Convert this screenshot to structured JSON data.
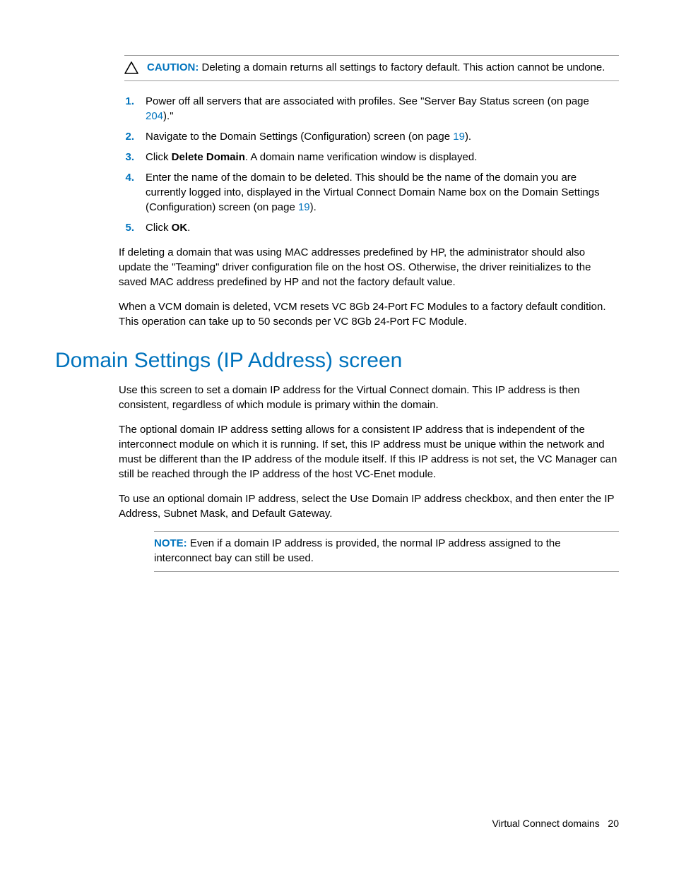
{
  "caution": {
    "label": "CAUTION:",
    "text": "Deleting a domain returns all settings to factory default. This action cannot be undone."
  },
  "steps": [
    {
      "num": "1.",
      "pre": "Power off all servers that are associated with profiles. See \"Server Bay Status screen (on page ",
      "link": "204",
      "post": ").\""
    },
    {
      "num": "2.",
      "pre": "Navigate to the Domain Settings (Configuration) screen (on page ",
      "link": "19",
      "post": ")."
    },
    {
      "num": "3.",
      "pre": "Click ",
      "bold": "Delete Domain",
      "post": ". A domain name verification window is displayed."
    },
    {
      "num": "4.",
      "pre": "Enter the name of the domain to be deleted. This should be the name of the domain you are currently logged into, displayed in the Virtual Connect Domain Name box on the Domain Settings (Configuration) screen (on page ",
      "link": "19",
      "post": ")."
    },
    {
      "num": "5.",
      "pre": "Click ",
      "bold": "OK",
      "post": "."
    }
  ],
  "para1": "If deleting a domain that was using MAC addresses predefined by HP, the administrator should also update the \"Teaming\" driver configuration file on the host OS. Otherwise, the driver reinitializes to the saved MAC address predefined by HP and not the factory default value.",
  "para2": "When a VCM domain is deleted, VCM resets VC 8Gb 24-Port FC Modules to a factory default condition. This operation can take up to 50 seconds per VC 8Gb 24-Port FC Module.",
  "heading": "Domain Settings (IP Address) screen",
  "para3": "Use this screen to set a domain IP address for the Virtual Connect domain. This IP address is then consistent, regardless of which module is primary within the domain.",
  "para4": "The optional domain IP address setting allows for a consistent IP address that is independent of the interconnect module on which it is running. If set, this IP address must be unique within the network and must be different than the IP address of the module itself. If this IP address is not set, the VC Manager can still be reached through the IP address of the host VC-Enet module.",
  "para5": "To use an optional domain IP address, select the Use Domain IP address checkbox, and then enter the IP Address, Subnet Mask, and Default Gateway.",
  "note": {
    "label": "NOTE:",
    "text": "Even if a domain IP address is provided, the normal IP address assigned to the interconnect bay can still be used."
  },
  "footer": {
    "section": "Virtual Connect domains",
    "page": "20"
  }
}
